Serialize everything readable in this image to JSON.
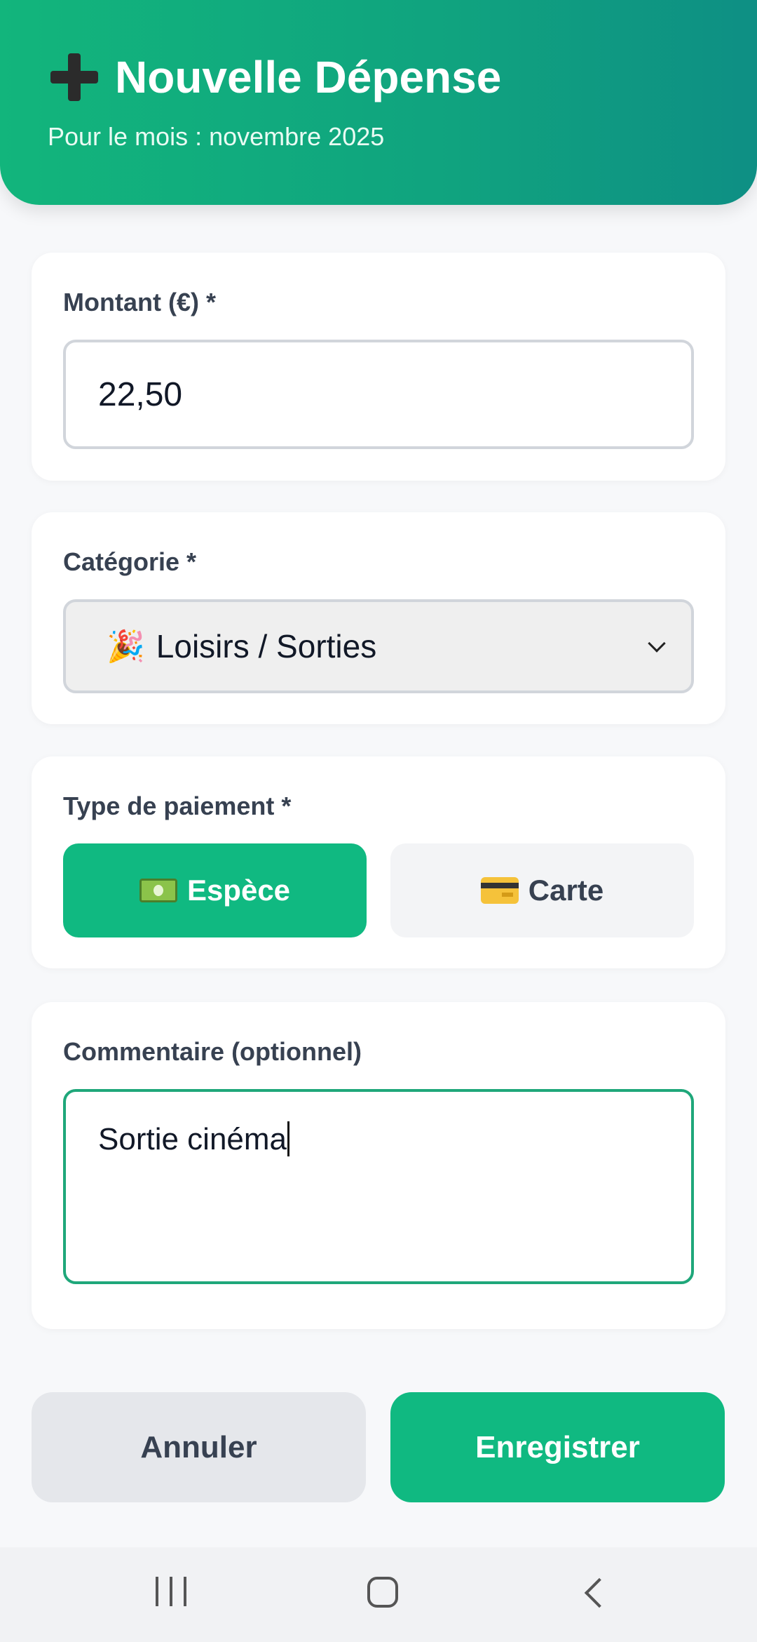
{
  "header": {
    "title": "Nouvelle Dépense",
    "subtitle": "Pour le mois : novembre 2025",
    "icon": "plus-icon"
  },
  "amount": {
    "label": "Montant (€) *",
    "value": "22,50"
  },
  "category": {
    "label": "Catégorie *",
    "selected": "Loisirs / Sorties",
    "icon": "party-popper-icon",
    "emoji": "🎉"
  },
  "payment": {
    "label": "Type de paiement *",
    "options": [
      {
        "label": "Espèce",
        "icon": "cash-icon",
        "active": true
      },
      {
        "label": "Carte",
        "icon": "credit-card-icon",
        "active": false
      }
    ]
  },
  "comment": {
    "label": "Commentaire (optionnel)",
    "value": "Sortie cinéma"
  },
  "actions": {
    "cancel": "Annuler",
    "save": "Enregistrer"
  },
  "colors": {
    "accent": "#10b981",
    "header_gradient_start": "#12b57c",
    "header_gradient_end": "#0e8f84"
  }
}
